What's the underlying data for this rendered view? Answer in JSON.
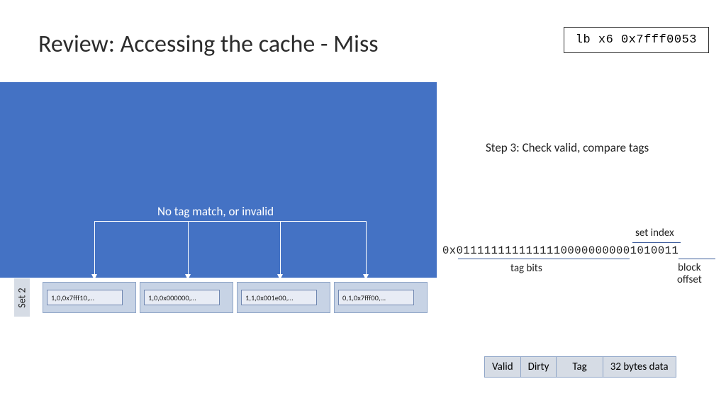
{
  "title": "Review: Accessing the cache - Miss",
  "instruction": "lb x6 0x7fff0053",
  "overlay_message": "No tag match, or invalid",
  "step_text": "Step 3: Check valid, compare tags",
  "set_label": "Set 2",
  "ways": [
    "1,0,0x7fff10,…",
    "1,0,0x000000,…",
    "1,1,0x001e00,…",
    "0,1,0x7fff00,…"
  ],
  "address": {
    "bits": "0x01111111111111100000000001010011",
    "labels": {
      "tag": "tag bits",
      "index": "set index",
      "offset": "block\noffset"
    }
  },
  "legend": [
    "Valid",
    "Dirty",
    "Tag",
    "32 bytes data"
  ]
}
